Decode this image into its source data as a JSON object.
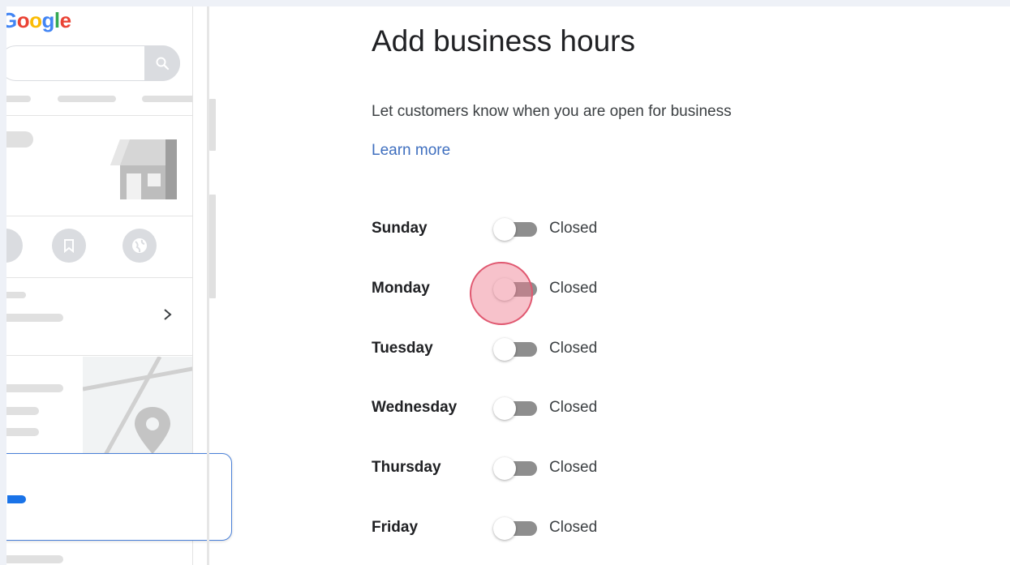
{
  "preview": {
    "logo_text": "Google",
    "logo_colors": [
      "#4285f4",
      "#ea4335",
      "#fbbc05",
      "#4285f4",
      "#34a853",
      "#ea4335"
    ]
  },
  "form": {
    "title": "Add business hours",
    "subtitle": "Let customers know when you are open for business",
    "learn_more": "Learn more",
    "days": [
      {
        "name": "Sunday",
        "status": "Closed"
      },
      {
        "name": "Monday",
        "status": "Closed"
      },
      {
        "name": "Tuesday",
        "status": "Closed"
      },
      {
        "name": "Wednesday",
        "status": "Closed"
      },
      {
        "name": "Thursday",
        "status": "Closed"
      },
      {
        "name": "Friday",
        "status": "Closed"
      }
    ]
  },
  "colors": {
    "link": "#3f6fbf",
    "toggle_track_off": "#8e8e8e",
    "click_indicator": "#e05870",
    "accent_bar": "#1a73e8"
  }
}
